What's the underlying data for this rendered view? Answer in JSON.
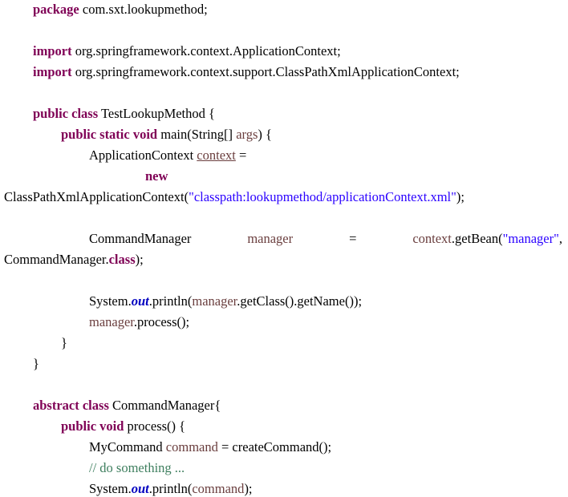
{
  "code": {
    "l1": {
      "kw": "package",
      "rest": " com.sxt.lookupmethod;"
    },
    "l2": {
      "kw": "import",
      "rest": " org.springframework.context.ApplicationContext;"
    },
    "l3": {
      "kw": "import",
      "rest": " org.springframework.context.support.ClassPathXmlApplicationContext;"
    },
    "l4": {
      "kw": "public class",
      "rest": " TestLookupMethod {"
    },
    "l5": {
      "kw": "public static void",
      "rest1": " main(String[] ",
      "var": "args",
      "rest2": ") {"
    },
    "l6": {
      "t1": "ApplicationContext ",
      "var": "context",
      "t2": " ="
    },
    "l7": {
      "kw": "new"
    },
    "l8": {
      "t1": "ClassPathXmlApplicationContext(",
      "str": "\"classpath:lookupmethod/applicationContext.xml\"",
      "t2": ");"
    },
    "l9": {
      "type": "CommandManager",
      "var": "manager",
      "eq": "=",
      "ctx": "context",
      "call": ".getBean(",
      "str": "\"manager\"",
      "end": ","
    },
    "l10": {
      "t1": "CommandManager.",
      "kw": "class",
      "t2": ");"
    },
    "l11": {
      "t1": "System.",
      "field": "out",
      "t2": ".println(",
      "var": "manager",
      "t3": ".getClass().getName());"
    },
    "l12": {
      "var": "manager",
      "t1": ".process();"
    },
    "l13": {
      "t": "}"
    },
    "l14": {
      "t": "}"
    },
    "l15": {
      "kw": "abstract class",
      "rest": " CommandManager{"
    },
    "l16": {
      "kw": "public void",
      "rest": " process() {"
    },
    "l17": {
      "t1": "MyCommand ",
      "var": "command",
      "t2": " = createCommand();"
    },
    "l18": {
      "cmt": "// do something ..."
    },
    "l19": {
      "t1": "System.",
      "field": "out",
      "t2": ".println(",
      "var": "command",
      "t3": ");"
    }
  }
}
